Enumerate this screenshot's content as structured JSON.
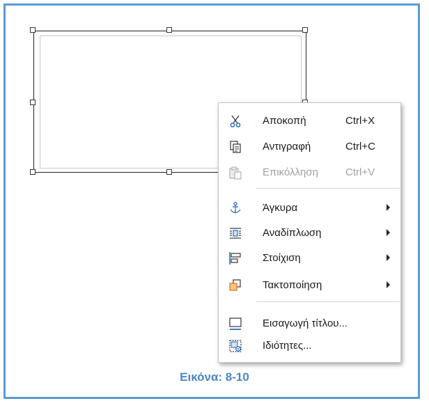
{
  "context_menu": {
    "items": [
      {
        "label": "Αποκοπή",
        "shortcut": "Ctrl+X",
        "icon": "scissors-icon",
        "enabled": true
      },
      {
        "label": "Αντιγραφή",
        "shortcut": "Ctrl+C",
        "icon": "copy-icon",
        "enabled": true
      },
      {
        "label": "Επικόλληση",
        "shortcut": "Ctrl+V",
        "icon": "paste-icon",
        "enabled": false
      },
      {
        "label": "Άγκυρα",
        "icon": "anchor-icon",
        "submenu": true
      },
      {
        "label": "Αναδίπλωση",
        "icon": "wrap-icon",
        "submenu": true
      },
      {
        "label": "Στοίχιση",
        "icon": "align-icon",
        "submenu": true
      },
      {
        "label": "Τακτοποίηση",
        "icon": "arrange-icon",
        "submenu": true
      },
      {
        "label": "Εισαγωγή τίτλου...",
        "icon": "caption-icon"
      },
      {
        "label": "Ιδιότητες...",
        "icon": "properties-icon"
      }
    ]
  },
  "caption": "Εικόνα: 8-10",
  "colors": {
    "frame": "#5b9bd5",
    "caption": "#4a86c5",
    "icon_blue": "#2a6ebb",
    "icon_orange": "#e8822a"
  }
}
